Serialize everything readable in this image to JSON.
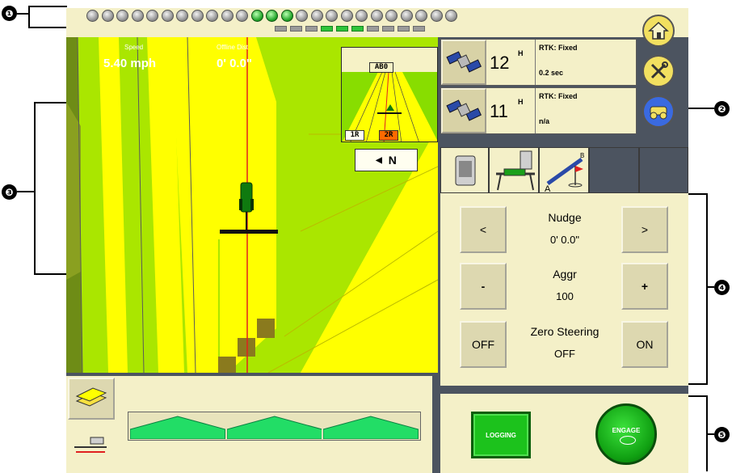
{
  "callouts": [
    "❶",
    "❷",
    "❸",
    "❹",
    "❺"
  ],
  "led_strip": {
    "leds_on": [
      11,
      12,
      13
    ],
    "segments_on": [
      3,
      4,
      5
    ]
  },
  "map": {
    "speed_label": "Speed",
    "speed_value": "5.40 mph",
    "offline_label": "Offline Dist",
    "offline_value": "0' 0.0\"",
    "perspective_line_label": "AB0",
    "row_labels": [
      "1R",
      "2R"
    ],
    "heading": "N",
    "colors": {
      "coverage": "#ffff00",
      "uncovered": "#aae600",
      "dark_band": "#6e8c16",
      "guide_line": "#e02020",
      "tractor": "#0f7a0f"
    }
  },
  "gps": [
    {
      "count": "12",
      "status": "RTK: Fixed",
      "age": "0.2 sec"
    },
    {
      "count": "11",
      "status": "RTK: Fixed",
      "age": "n/a"
    }
  ],
  "side_buttons": [
    "home-icon",
    "tools-icon",
    "vehicle-icon"
  ],
  "tabs": [
    "guidance-unit-icon",
    "implement-icon",
    "ab-line-icon",
    "",
    ""
  ],
  "guidance": {
    "nudge_label": "Nudge",
    "nudge_value": "0' 0.0\"",
    "nudge_left": "<",
    "nudge_right": ">",
    "aggr_label": "Aggr",
    "aggr_value": "100",
    "aggr_minus": "-",
    "aggr_plus": "+",
    "zero_label": "Zero Steering",
    "zero_value": "OFF",
    "zero_off": "OFF",
    "zero_on": "ON"
  },
  "logging": {
    "logging_label": "LOGGING",
    "engage_label": "ENGAGE"
  },
  "sections": {
    "count": 3,
    "color": "#22dd66"
  }
}
